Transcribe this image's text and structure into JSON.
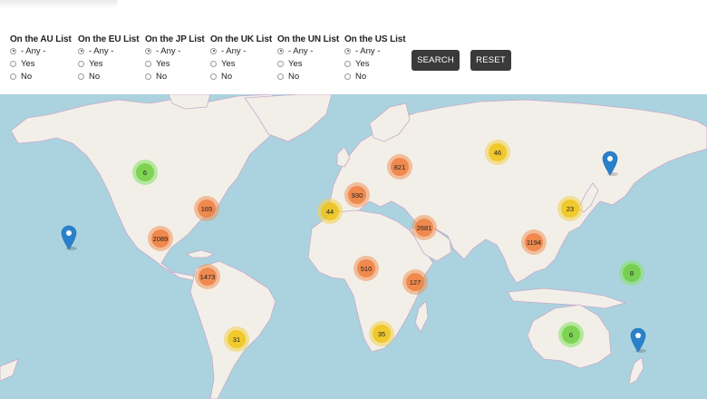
{
  "filters": [
    {
      "title": "On the AU List",
      "options": [
        "- Any -",
        "Yes",
        "No"
      ],
      "selected": 0
    },
    {
      "title": "On the EU List",
      "options": [
        "- Any -",
        "Yes",
        "No"
      ],
      "selected": 0
    },
    {
      "title": "On the JP List",
      "options": [
        "- Any -",
        "Yes",
        "No"
      ],
      "selected": 0
    },
    {
      "title": "On the UK List",
      "options": [
        "- Any -",
        "Yes",
        "No"
      ],
      "selected": 0
    },
    {
      "title": "On the UN List",
      "options": [
        "- Any -",
        "Yes",
        "No"
      ],
      "selected": 0
    },
    {
      "title": "On the US List",
      "options": [
        "- Any -",
        "Yes",
        "No"
      ],
      "selected": 0
    }
  ],
  "buttons": {
    "search": "SEARCH",
    "reset": "RESET"
  },
  "colors": {
    "ocean": "#aad3df",
    "land": "#f2efe9",
    "border": "#c9a9c9",
    "button": "#3a3a3a",
    "pin": "#2a81cb"
  },
  "clusters": [
    {
      "label": "6",
      "level": "green",
      "region": "western-canada"
    },
    {
      "label": "165",
      "level": "orange",
      "region": "eastern-usa"
    },
    {
      "label": "2089",
      "level": "orange",
      "region": "mexico"
    },
    {
      "label": "1473",
      "level": "orange",
      "region": "colombia"
    },
    {
      "label": "31",
      "level": "yellow",
      "region": "southern-brazil"
    },
    {
      "label": "44",
      "level": "yellow",
      "region": "morocco"
    },
    {
      "label": "930",
      "level": "orange",
      "region": "europe"
    },
    {
      "label": "821",
      "level": "orange",
      "region": "russia-west"
    },
    {
      "label": "46",
      "level": "yellow",
      "region": "siberia"
    },
    {
      "label": "2681",
      "level": "orange",
      "region": "middle-east"
    },
    {
      "label": "510",
      "level": "orange",
      "region": "central-africa"
    },
    {
      "label": "127",
      "level": "orange",
      "region": "east-africa"
    },
    {
      "label": "35",
      "level": "yellow",
      "region": "south-africa"
    },
    {
      "label": "1194",
      "level": "orange",
      "region": "southeast-asia"
    },
    {
      "label": "23",
      "level": "yellow",
      "region": "japan"
    },
    {
      "label": "8",
      "level": "green",
      "region": "papua-new-guinea"
    },
    {
      "label": "6",
      "level": "green",
      "region": "australia"
    }
  ],
  "markers": [
    {
      "name": "hawaii-pin"
    },
    {
      "name": "kamchatka-pin"
    },
    {
      "name": "new-zealand-pin"
    }
  ]
}
